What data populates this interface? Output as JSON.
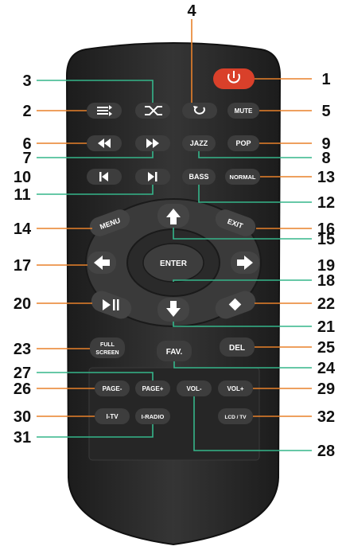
{
  "colors": {
    "body": "#2b2b2b",
    "button": "#3d3d3d",
    "power": "#d9402a",
    "orange_leader": "#e8812a",
    "green_leader": "#35b58a"
  },
  "buttons": {
    "power": {
      "icon": "power-icon"
    },
    "shuffle": {
      "icon": "shuffle-icon"
    },
    "repeat": {
      "icon": "repeat-icon"
    },
    "playlist": {
      "icon": "playlist-icon"
    },
    "rewind": {
      "icon": "rewind-icon"
    },
    "fast_forward": {
      "icon": "fast-forward-icon"
    },
    "prev": {
      "icon": "skip-previous-icon"
    },
    "next": {
      "icon": "skip-next-icon"
    },
    "mute": "MUTE",
    "jazz": "JAZZ",
    "pop": "POP",
    "bass": "BASS",
    "normal": "NORMAL",
    "menu": "MENU",
    "exit": "EXIT",
    "enter": "ENTER",
    "fullscreen_line1": "FULL",
    "fullscreen_line2": "SCREEN",
    "fav": "FAV.",
    "del": "DEL",
    "page_minus": "PAGE-",
    "page_plus": "PAGE+",
    "vol_minus": "VOL-",
    "vol_plus": "VOL+",
    "itv": "I-TV",
    "iradio": "I-RADIO",
    "lcd_tv": "LCD / TV"
  },
  "callouts": {
    "n1": "1",
    "n2": "2",
    "n3": "3",
    "n4": "4",
    "n5": "5",
    "n6": "6",
    "n7": "7",
    "n8": "8",
    "n9": "9",
    "n10": "10",
    "n11": "11",
    "n12": "12",
    "n13": "13",
    "n14": "14",
    "n15": "15",
    "n16": "16",
    "n17": "17",
    "n18": "18",
    "n19": "19",
    "n20": "20",
    "n21": "21",
    "n22": "22",
    "n23": "23",
    "n24": "24",
    "n25": "25",
    "n26": "26",
    "n27": "27",
    "n28": "28",
    "n29": "29",
    "n30": "30",
    "n31": "31",
    "n32": "32"
  }
}
